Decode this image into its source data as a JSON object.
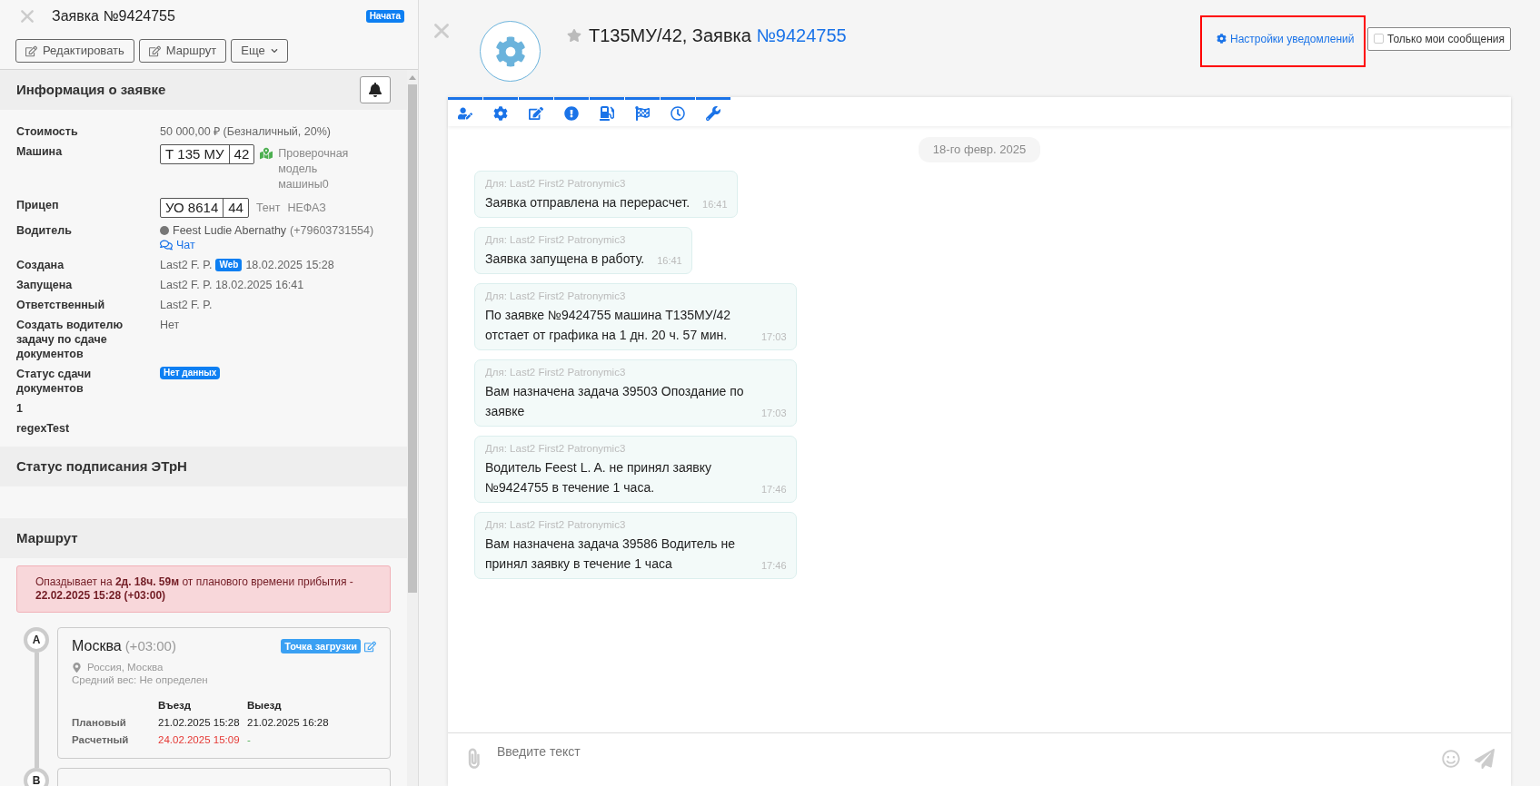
{
  "order_panel": {
    "title": "Заявка №9424755",
    "status": "Начата",
    "actions": [
      {
        "kind": "edit",
        "label": "Редактировать"
      },
      {
        "kind": "edit",
        "label": "Маршрут"
      },
      {
        "kind": "dropdown",
        "label": "Еще"
      }
    ],
    "info_section": {
      "title": "Информация о заявке",
      "rows": [
        {
          "kind": "text",
          "label": "Стоимость",
          "value": "50 000,00 ₽ (Безналичный, 20%)"
        },
        {
          "kind": "vehicle",
          "label": "Машина",
          "plate": "Т 135 МУ",
          "region": "42",
          "model": "Проверочная модель машины0"
        },
        {
          "kind": "trailer",
          "label": "Прицеп",
          "plate": "УО 8614",
          "region": "44",
          "body": "Тент",
          "brand": "НЕФАЗ"
        },
        {
          "kind": "driver",
          "label": "Водитель",
          "name": "Feest Ludie Abernathy",
          "phone": "(+79603731554)",
          "chat": "Чат"
        },
        {
          "kind": "author",
          "label": "Создана",
          "user": "Last2 F. P.",
          "source": "Web",
          "date": "18.02.2025 15:28"
        },
        {
          "kind": "text",
          "label": "Запущена",
          "value": "Last2 F. P. 18.02.2025 16:41"
        },
        {
          "kind": "text",
          "label": "Ответственный",
          "value": "Last2 F. P."
        },
        {
          "kind": "text",
          "label": "Создать водителю задачу по сдаче документов",
          "value": "Нет"
        },
        {
          "kind": "badge",
          "label": "Статус сдачи документов",
          "value": "Нет данных"
        },
        {
          "kind": "empty",
          "label": "1"
        },
        {
          "kind": "empty",
          "label": "regexTest"
        }
      ]
    },
    "signing_section": {
      "title": "Статус подписания ЭТрН"
    },
    "route_section": {
      "title": "Маршрут",
      "delay_alert": "Опаздывает на **2д. 18ч. 59м** от планового времени прибытия - **22.02.2025 15:28 (+03:00)**",
      "points": [
        {
          "letter": "A",
          "city": "Москва",
          "tz": "(+03:00)",
          "type": "Точка загрузки",
          "address": "Россия, Москва",
          "weight": "Средний вес: Не определен",
          "columns": [
            "Въезд",
            "Выезд"
          ],
          "times": [
            {
              "label": "Плановый",
              "in": "21.02.2025 15:28",
              "out": "21.02.2025 16:28",
              "late": false
            },
            {
              "label": "Расчетный",
              "in": "24.02.2025 15:09",
              "out": "-",
              "late": true
            }
          ]
        },
        {
          "letter": "B"
        }
      ]
    }
  },
  "chat": {
    "title": "Т135МУ/42, Заявка ",
    "order_link": "№9424755",
    "starred": false,
    "notification_settings": {
      "label": "Настройки уведомлений",
      "highlighted": true
    },
    "only_mine": {
      "label": "Только мои сообщения",
      "checked": false
    },
    "filters": [
      {
        "kind": "driver",
        "on": true
      },
      {
        "kind": "settings",
        "on": true
      },
      {
        "kind": "edit",
        "on": true
      },
      {
        "kind": "alert",
        "on": true
      },
      {
        "kind": "fuel",
        "on": true
      },
      {
        "kind": "finish",
        "on": true
      },
      {
        "kind": "time",
        "on": true
      },
      {
        "kind": "repair",
        "on": true
      }
    ],
    "date": "18-го февр. 2025",
    "messages": [
      {
        "to": "Для: Last2 First2 Patronymic3",
        "text": "Заявка отправлена на перерасчет.",
        "time": "16:41"
      },
      {
        "to": "Для: Last2 First2 Patronymic3",
        "text": "Заявка запущена в работу.",
        "time": "16:41"
      },
      {
        "to": "Для: Last2 First2 Patronymic3",
        "text": "По заявке №9424755 машина Т135МУ/42 отстает от графика на 1 дн. 20 ч. 57 мин.",
        "time": "17:03"
      },
      {
        "to": "Для: Last2 First2 Patronymic3",
        "text": "Вам назначена задача 39503 Опоздание по заявке",
        "time": "17:03"
      },
      {
        "to": "Для: Last2 First2 Patronymic3",
        "text": "Водитель Feest L. A. не принял заявку №9424755 в течение 1 часа.",
        "time": "17:46"
      },
      {
        "to": "Для: Last2 First2 Patronymic3",
        "text": "Вам назначена задача 39586 Водитель не принял заявку в течение 1 часа",
        "time": "17:46"
      }
    ],
    "input": {
      "placeholder": "Введите текст"
    }
  }
}
